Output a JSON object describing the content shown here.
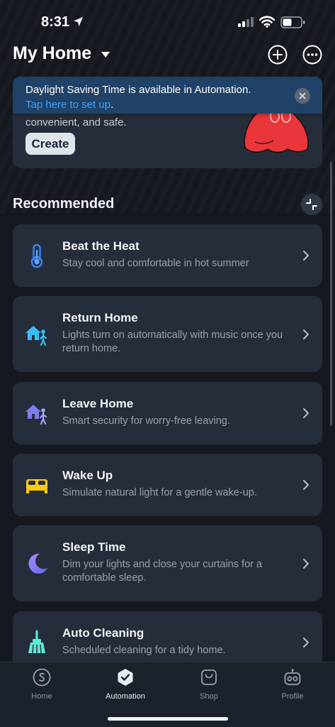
{
  "status_bar": {
    "time": "8:31"
  },
  "header": {
    "title": "My Home"
  },
  "banner": {
    "line1": "Daylight Saving Time is available in Automation.",
    "link": "Tap here to set up",
    "link_suffix": "."
  },
  "promo": {
    "text": "convenient, and safe.",
    "create_label": "Create"
  },
  "section": {
    "title": "Recommended"
  },
  "cards": [
    {
      "title": "Beat the Heat",
      "desc": "Stay cool and comfortable in hot summer",
      "icon": "thermometer-icon"
    },
    {
      "title": "Return Home",
      "desc": "Lights turn on automatically with music once you return home.",
      "icon": "return-home-icon"
    },
    {
      "title": "Leave Home",
      "desc": "Smart security for worry-free leaving.",
      "icon": "leave-home-icon"
    },
    {
      "title": "Wake Up",
      "desc": "Simulate natural light for a gentle wake-up.",
      "icon": "bed-icon"
    },
    {
      "title": "Sleep Time",
      "desc": "Dim your lights and close your curtains for a comfortable sleep.",
      "icon": "moon-icon"
    },
    {
      "title": "Auto Cleaning",
      "desc": "Scheduled cleaning for a tidy home.",
      "icon": "broom-icon"
    }
  ],
  "nav": {
    "home": "Home",
    "automation": "Automation",
    "shop": "Shop",
    "profile": "Profile"
  },
  "colors": {
    "background": "#15191f",
    "card": "#262d3a",
    "banner": "#1f4266",
    "link": "#3ea1ff"
  }
}
